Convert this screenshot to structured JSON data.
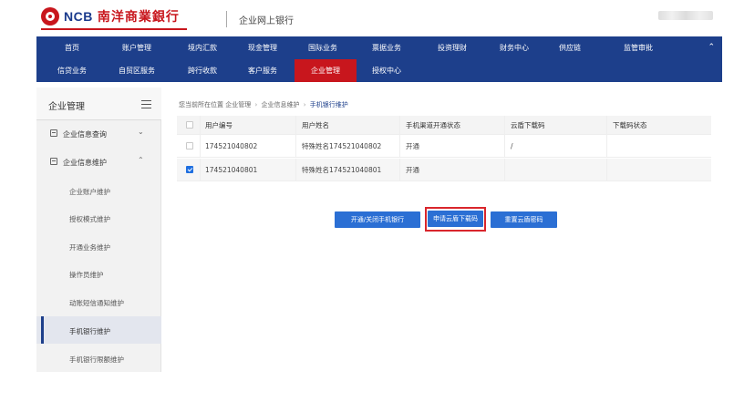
{
  "header": {
    "logo_text": "NCB",
    "logo_cn": "南洋商業銀行",
    "site_title": "企业网上银行"
  },
  "nav": {
    "row1": [
      "首页",
      "账户管理",
      "境内汇款",
      "现金管理",
      "国际业务",
      "票据业务",
      "投资理财",
      "财务中心",
      "供应链",
      "监管审批"
    ],
    "row2": [
      "信贷业务",
      "自贸区服务",
      "跨行收款",
      "客户服务",
      "企业管理",
      "授权中心"
    ],
    "active": "企业管理",
    "collapse_icon": "⌃"
  },
  "sidebar": {
    "title": "企业管理",
    "groups": [
      {
        "label": "企业信息查询",
        "chevron": "⌄"
      },
      {
        "label": "企业信息维护",
        "chevron": "⌃"
      }
    ],
    "items": [
      {
        "label": "企业账户维护"
      },
      {
        "label": "授权模式维护"
      },
      {
        "label": "开通业务维护"
      },
      {
        "label": "操作员维护"
      },
      {
        "label": "动账短信通知维护"
      },
      {
        "label": "手机银行维护",
        "active": true
      },
      {
        "label": "手机银行限额维护"
      }
    ]
  },
  "breadcrumb": {
    "prefix": "您当前所在位置",
    "crumbs": [
      "企业管理",
      "企业信息维护",
      "手机银行维护"
    ]
  },
  "table": {
    "columns": [
      "用户编号",
      "用户姓名",
      "手机渠道开通状态",
      "云盾下载码",
      "下载码状态"
    ],
    "rows": [
      {
        "checked": false,
        "cells": [
          "174521040802",
          "特殊姓名174521040802",
          "开通",
          "/",
          ""
        ]
      },
      {
        "checked": true,
        "cells": [
          "174521040801",
          "特殊姓名174521040801",
          "开通",
          "",
          ""
        ]
      }
    ]
  },
  "buttons": {
    "toggle_mobile": "开通/关闭手机银行",
    "apply_code": "申请云盾下载码",
    "reset_pin": "重置云盾密码"
  },
  "colors": {
    "nav_bg": "#1d3f8b",
    "active_red": "#c8161d",
    "button_blue": "#2b6fd4",
    "highlight_red": "#d9262c"
  }
}
